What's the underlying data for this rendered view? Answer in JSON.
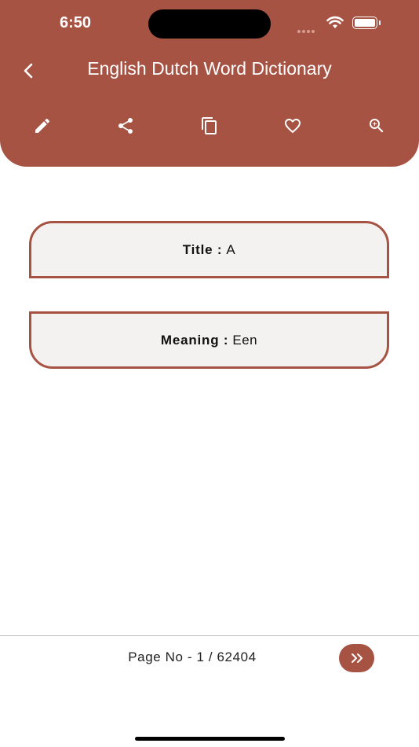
{
  "status_bar": {
    "time": "6:50"
  },
  "header": {
    "title": "English Dutch Word Dictionary"
  },
  "toolbar": {
    "icons": [
      "edit-icon",
      "share-icon",
      "copy-icon",
      "favorite-icon",
      "zoom-in-icon"
    ]
  },
  "word": {
    "title_label": "Title :",
    "title_value": "A",
    "meaning_label": "Meaning :",
    "meaning_value": "Een"
  },
  "footer": {
    "page_text": "Page No - 1 / 62404",
    "next_label": "»"
  },
  "colors": {
    "brand": "#a65344",
    "card_bg": "#f3f2f0"
  }
}
